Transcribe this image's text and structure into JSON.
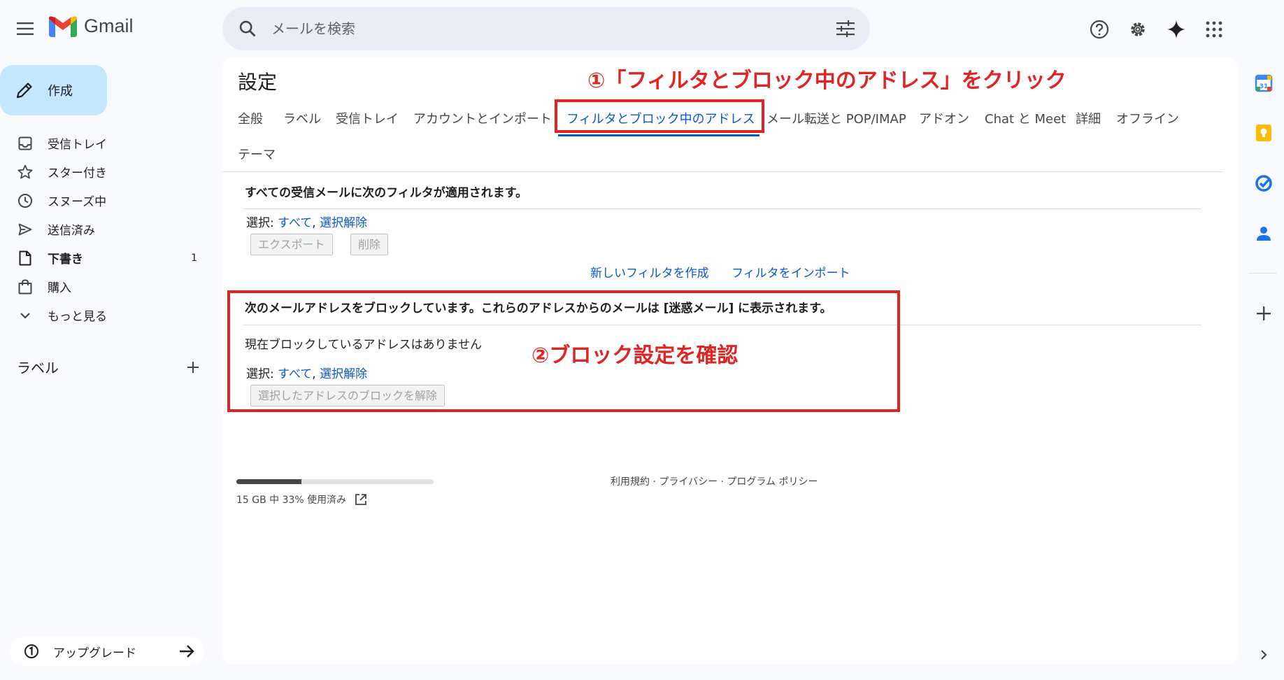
{
  "app": {
    "name": "Gmail"
  },
  "search": {
    "placeholder": "メールを検索"
  },
  "colors": {
    "accent": "#0b57d0",
    "compose_bg": "#c2e7ff",
    "annotation": "#e02424"
  },
  "compose": {
    "label": "作成"
  },
  "nav": {
    "items": [
      {
        "label": "受信トレイ",
        "icon": "inbox-icon"
      },
      {
        "label": "スター付き",
        "icon": "star-icon"
      },
      {
        "label": "スヌーズ中",
        "icon": "clock-icon"
      },
      {
        "label": "送信済み",
        "icon": "send-icon"
      },
      {
        "label": "下書き",
        "icon": "draft-icon",
        "count": "1"
      },
      {
        "label": "購入",
        "icon": "shopping-bag-icon"
      },
      {
        "label": "もっと見る",
        "icon": "chevron-down-icon"
      }
    ]
  },
  "labels": {
    "title": "ラベル"
  },
  "upgrade": {
    "label": "アップグレード"
  },
  "settings": {
    "title": "設定",
    "tabs": [
      {
        "label": "全般"
      },
      {
        "label": "ラベル"
      },
      {
        "label": "受信トレイ"
      },
      {
        "label": "アカウントとインポート"
      },
      {
        "label": "フィルタとブロック中のアドレス",
        "active": true
      },
      {
        "label": "メール転送と POP/IMAP"
      },
      {
        "label": "アドオン"
      },
      {
        "label": "Chat と Meet"
      },
      {
        "label": "詳細"
      },
      {
        "label": "オフライン"
      },
      {
        "label": "テーマ"
      }
    ],
    "filters": {
      "header": "すべての受信メールに次のフィルタが適用されます。",
      "select_label": "選択: ",
      "select_all": "すべて",
      "select_none": "選択解除",
      "export_button": "エクスポート",
      "delete_button": "削除",
      "create_filter": "新しいフィルタを作成",
      "import_filter": "フィルタをインポート"
    },
    "blocked": {
      "header": "次のメールアドレスをブロックしています。これらのアドレスからのメールは [迷惑メール] に表示されます。",
      "empty": "現在ブロックしているアドレスはありません",
      "select_label": "選択: ",
      "select_all": "すべて",
      "select_none": "選択解除",
      "unblock_button": "選択したアドレスのブロックを解除"
    }
  },
  "storage": {
    "text": "15 GB 中 33% 使用済み",
    "percent": 33
  },
  "footer": {
    "links": "利用規約 · プライバシー · プログラム ポリシー"
  },
  "annotations": {
    "step1": "①「フィルタとブロック中のアドレス」をクリック",
    "step2": "②ブロック設定を確認"
  }
}
